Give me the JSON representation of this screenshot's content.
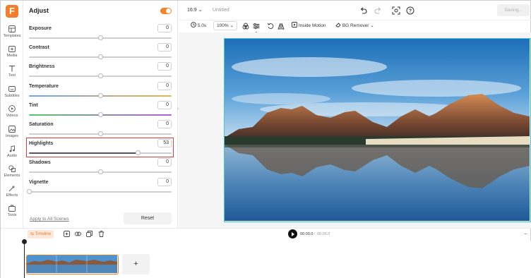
{
  "app": {
    "logo_letter": "F"
  },
  "rail": {
    "items": [
      {
        "label": "Templates",
        "icon": "templates-icon"
      },
      {
        "label": "Media",
        "icon": "media-icon"
      },
      {
        "label": "Text",
        "icon": "text-icon"
      },
      {
        "label": "Subtitles",
        "icon": "subtitles-icon"
      },
      {
        "label": "Videos",
        "icon": "videos-icon"
      },
      {
        "label": "Images",
        "icon": "images-icon"
      },
      {
        "label": "Audio",
        "icon": "audio-icon"
      },
      {
        "label": "Elements",
        "icon": "elements-icon"
      },
      {
        "label": "Effects",
        "icon": "effects-icon"
      },
      {
        "label": "Tools",
        "icon": "tools-icon"
      }
    ]
  },
  "panel": {
    "title": "Adjust",
    "toggle_on": true,
    "sliders": [
      {
        "label": "Exposure",
        "value": "0",
        "level": 0.5,
        "track": "gray"
      },
      {
        "label": "Contrast",
        "value": "0",
        "level": 0.5,
        "track": "gray"
      },
      {
        "label": "Brightness",
        "value": "0",
        "level": 0.5,
        "track": "gray"
      },
      {
        "label": "Temperature",
        "value": "0",
        "level": 0.5,
        "track": "temperature"
      },
      {
        "label": "Tint",
        "value": "0",
        "level": 0.5,
        "track": "tint"
      },
      {
        "label": "Saturation",
        "value": "0",
        "level": 0.5,
        "track": "gray"
      },
      {
        "label": "Highlights",
        "value": "53",
        "level": 0.765,
        "track": "highlights"
      },
      {
        "label": "Shadows",
        "value": "0",
        "level": 0.5,
        "track": "gray"
      },
      {
        "label": "Vignette",
        "value": "0",
        "level": 0.0,
        "track": "gray"
      }
    ],
    "apply_all": "Apply to All Scenes",
    "reset": "Reset"
  },
  "header": {
    "ratio": "16:9",
    "title": "Untitled",
    "saving": "Saving..."
  },
  "toolbar": {
    "duration": "5.0s",
    "zoom": "100%",
    "tooltip": "Adjust",
    "inside_motion": "Inside Motion",
    "bg_remover": "BG Remover"
  },
  "timeline": {
    "tab": "Timeline",
    "current_time": "00:00.0",
    "separator": "/",
    "total_time": "00:05.0",
    "add": "+"
  },
  "colors": {
    "accent": "#f5832a",
    "highlight_border": "#e23c3c",
    "selection": "#42c6d6"
  }
}
